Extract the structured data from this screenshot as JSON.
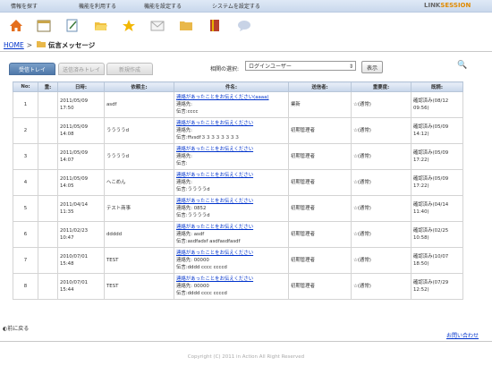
{
  "topnav": {
    "items": [
      "情報を探す",
      "機能を利用する",
      "機能を設定する",
      "システムを設定する"
    ],
    "brand_left": "LINK",
    "brand_right": "SESSION"
  },
  "icons": [
    "home-icon",
    "calendar-icon",
    "notepad-icon",
    "folder-open-icon",
    "star-icon",
    "mail-icon",
    "folder-icon",
    "book-icon",
    "chat-icon"
  ],
  "breadcrumb": {
    "home": "HOME",
    "sep": ">",
    "title": "伝言メッセージ"
  },
  "tabs": [
    "受信トレイ",
    "送信済みトレイ",
    "新規作成"
  ],
  "filter": {
    "label": "相関の選択:",
    "value": "ログインユーザー",
    "button": "表示"
  },
  "table": {
    "headers": [
      "No:",
      "重:",
      "日時:",
      "依頼主:",
      "件名:",
      "送信者:",
      "重要度:",
      "既読:"
    ],
    "rows": [
      {
        "no": "1",
        "flag": "",
        "date": "2011/05/09",
        "time": "17:50",
        "requester": "asdf",
        "subject": "連絡があったことをお伝えください(aaaa)",
        "contact": "連絡先:",
        "message": "伝言:cccc",
        "sender": "業新",
        "priority": "☆(通常)",
        "read1": "確認済み(08/12",
        "read2": "09:56)"
      },
      {
        "no": "2",
        "flag": "",
        "date": "2011/05/09",
        "time": "14:08",
        "requester": "ううううd",
        "subject": "連絡があったことをお伝えください",
        "contact": "連絡先:",
        "message": "伝言:ffvsdf３３３３３３３３",
        "sender": "初期管理者",
        "priority": "☆(通常)",
        "read1": "確認済み(05/09",
        "read2": "14:12)"
      },
      {
        "no": "3",
        "flag": "",
        "date": "2011/05/09",
        "time": "14:07",
        "requester": "ううううd",
        "subject": "連絡があったことをお伝えください",
        "contact": "連絡先:",
        "message": "伝言:",
        "sender": "初期管理者",
        "priority": "☆(通常)",
        "read1": "確認済み(05/09",
        "read2": "17:22)"
      },
      {
        "no": "4",
        "flag": "",
        "date": "2011/05/09",
        "time": "14:05",
        "requester": "へこめん",
        "subject": "連絡があったことをお伝えください",
        "contact": "連絡先:",
        "message": "伝言:ううううd",
        "sender": "初期管理者",
        "priority": "☆(通常)",
        "read1": "確認済み(05/09",
        "read2": "17:22)"
      },
      {
        "no": "5",
        "flag": "",
        "date": "2011/04/14",
        "time": "11:35",
        "requester": "テスト商事",
        "subject": "連絡があったことをお伝えください",
        "contact": "連絡先: 0852",
        "message": "伝言:ううううd",
        "sender": "初期管理者",
        "priority": "☆(通常)",
        "read1": "確認済み(04/14",
        "read2": "11:40)"
      },
      {
        "no": "6",
        "flag": "",
        "date": "2011/02/23",
        "time": "10:47",
        "requester": "ddddd",
        "subject": "連絡があったことをお伝えください",
        "contact": "連絡先: asdf",
        "message": "伝言:asdfadsf asdfasdfasdf",
        "sender": "初期管理者",
        "priority": "☆(通常)",
        "read1": "確認済み(02/25",
        "read2": "10:58)"
      },
      {
        "no": "7",
        "flag": "",
        "date": "2010/07/01",
        "time": "15:48",
        "requester": "TEST",
        "subject": "連絡があったことをお伝えください",
        "contact": "連絡先: 00000",
        "message": "伝言:dddd cccc ccccd",
        "sender": "初期管理者",
        "priority": "☆(通常)",
        "read1": "確認済み(10/07",
        "read2": "18:50)"
      },
      {
        "no": "8",
        "flag": "",
        "date": "2010/07/01",
        "time": "15:44",
        "requester": "TEST",
        "subject": "連絡があったことをお伝えください",
        "contact": "連絡先: 00000",
        "message": "伝言:dddd cccc ccccd",
        "sender": "初期管理者",
        "priority": "☆(通常)",
        "read1": "確認済み(07/29",
        "read2": "12:52)"
      }
    ]
  },
  "footer": {
    "back": "前に戻る",
    "inquiry": "お問い合わせ",
    "copyright": "Copyright (C) 2011 in Action All Right Reserved"
  }
}
